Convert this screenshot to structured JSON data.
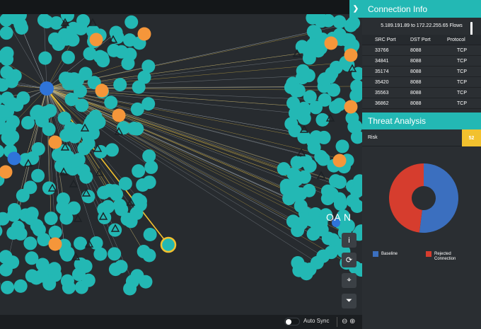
{
  "colors": {
    "teal": "#23b8b4",
    "orange": "#f5963a",
    "blue": "#2f74d9",
    "accent": "#23b8b4",
    "risk": "#f2c12e",
    "baseline": "#3b6fbf",
    "rejected": "#d63d2e"
  },
  "graph": {
    "overflow_label": "OA N",
    "side_tools": [
      {
        "name": "info-icon",
        "glyph": "i"
      },
      {
        "name": "refresh-icon",
        "glyph": "⟳"
      },
      {
        "name": "crosshair-icon",
        "glyph": "⌖"
      },
      {
        "name": "filter-icon",
        "glyph": "⏷"
      }
    ]
  },
  "bottom": {
    "auto_sync_label": "Auto Sync",
    "zoom_out_glyph": "⊖",
    "zoom_in_glyph": "⊕"
  },
  "connection_info": {
    "title": "Connection Info",
    "flows_label": "5.189.191.89 to 172.22.255.65 Flows",
    "columns": [
      "SRC Port",
      "DST Port",
      "Protocol"
    ],
    "rows": [
      [
        "33766",
        "8088",
        "TCP"
      ],
      [
        "34841",
        "8088",
        "TCP"
      ],
      [
        "35174",
        "8088",
        "TCP"
      ],
      [
        "35420",
        "8088",
        "TCP"
      ],
      [
        "35563",
        "8088",
        "TCP"
      ],
      [
        "36862",
        "8088",
        "TCP"
      ]
    ]
  },
  "threat_analysis": {
    "title": "Threat Analysis",
    "risk_label": "Risk",
    "risk_value": "52"
  },
  "chart_data": {
    "type": "pie",
    "donut": true,
    "categories": [
      "Baseline",
      "Rejected Connection"
    ],
    "values": [
      52,
      48
    ],
    "colors": [
      "#3b6fbf",
      "#d63d2e"
    ],
    "legend": [
      "Baseline",
      "Rejected Connection"
    ],
    "legend_placement": "bottom"
  }
}
